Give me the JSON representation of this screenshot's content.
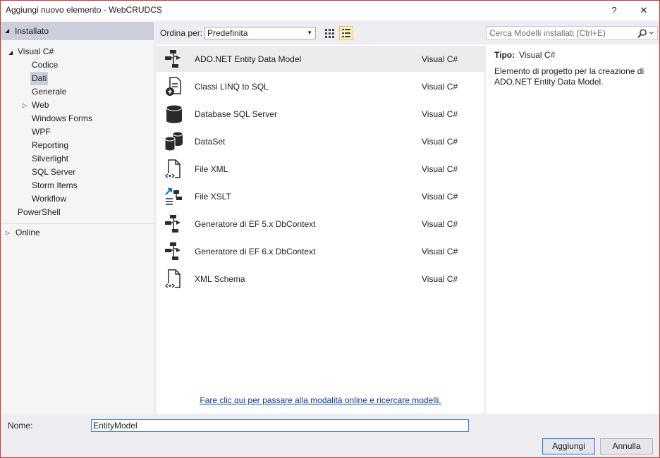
{
  "window": {
    "title": "Aggiungi nuovo elemento - WebCRUDCS",
    "help_label": "?",
    "close_label": "✕"
  },
  "sidebar": {
    "installed_label": "Installato",
    "tree": {
      "root_label": "Visual C#",
      "children": [
        {
          "label": "Codice"
        },
        {
          "label": "Dati",
          "selected": true
        },
        {
          "label": "Generale"
        },
        {
          "label": "Web",
          "expandable": true
        },
        {
          "label": "Windows Forms"
        },
        {
          "label": "WPF"
        },
        {
          "label": "Reporting"
        },
        {
          "label": "Silverlight"
        },
        {
          "label": "SQL Server"
        },
        {
          "label": "Storm Items"
        },
        {
          "label": "Workflow"
        }
      ],
      "powershell_label": "PowerShell"
    },
    "online_label": "Online"
  },
  "toolbar": {
    "sort_label": "Ordina per:",
    "sort_value": "Predefinita",
    "search_placeholder": "Cerca Modelli installati (Ctrl+E)"
  },
  "templates": [
    {
      "name": "ADO.NET Entity Data Model",
      "lang": "Visual C#",
      "icon": "entity-model-icon",
      "selected": true
    },
    {
      "name": "Classi LINQ to SQL",
      "lang": "Visual C#",
      "icon": "linq-to-sql-icon"
    },
    {
      "name": "Database SQL Server",
      "lang": "Visual C#",
      "icon": "database-icon"
    },
    {
      "name": "DataSet",
      "lang": "Visual C#",
      "icon": "dataset-icon"
    },
    {
      "name": "File XML",
      "lang": "Visual C#",
      "icon": "xml-file-icon"
    },
    {
      "name": "File XSLT",
      "lang": "Visual C#",
      "icon": "xslt-file-icon"
    },
    {
      "name": "Generatore di EF 5.x DbContext",
      "lang": "Visual C#",
      "icon": "ef-generator-icon"
    },
    {
      "name": "Generatore di EF 6.x DbContext",
      "lang": "Visual C#",
      "icon": "ef-generator-icon"
    },
    {
      "name": "XML Schema",
      "lang": "Visual C#",
      "icon": "xml-schema-icon"
    }
  ],
  "online_link": "Fare clic qui per passare alla modalità online e ricercare modelli.",
  "details": {
    "type_label": "Tipo:",
    "type_value": "Visual C#",
    "description": "Elemento di progetto per la creazione di ADO.NET Entity Data Model."
  },
  "footer": {
    "name_label": "Nome:",
    "name_value": "EntityModel",
    "add_label": "Aggiungi",
    "cancel_label": "Annulla"
  },
  "colors": {
    "accent": "#3c7fd4",
    "selection": "#cccedb",
    "border": "#c73a3a"
  }
}
